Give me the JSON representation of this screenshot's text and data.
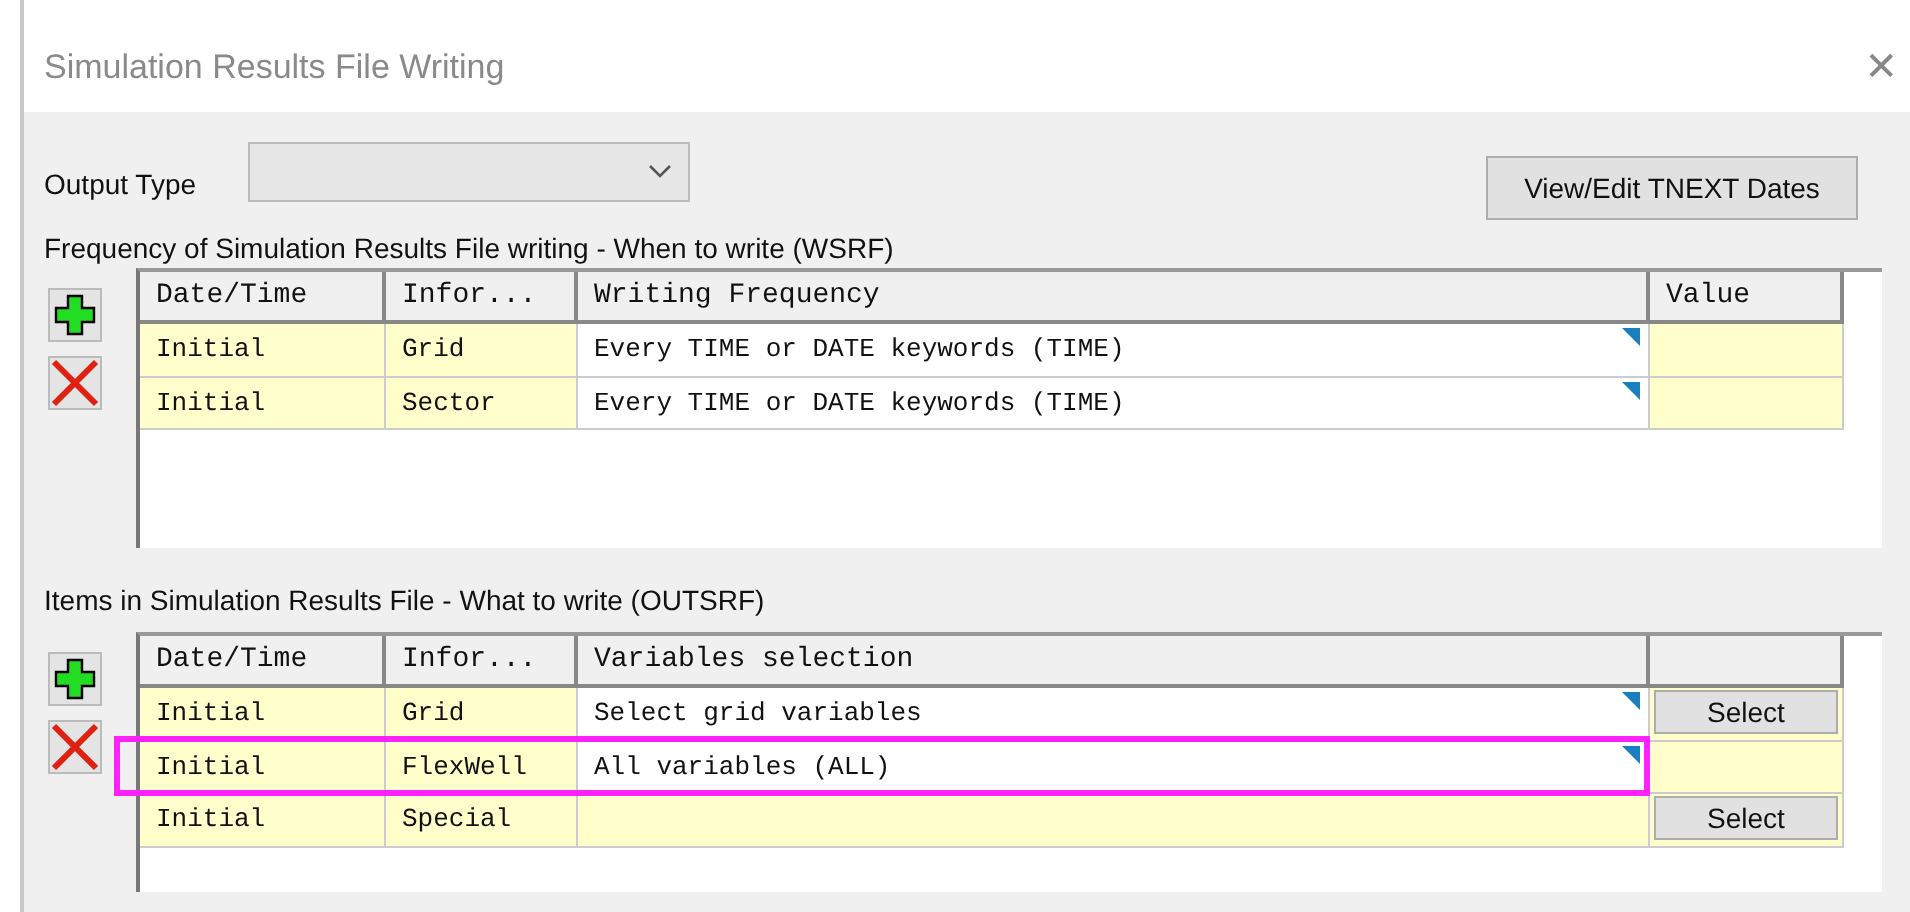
{
  "window": {
    "title": "Simulation Results File Writing",
    "close": "✕"
  },
  "output_type": {
    "label": "Output Type"
  },
  "tnext_button": "View/Edit TNEXT Dates",
  "frequency": {
    "label": "Frequency of Simulation Results File writing -  When to write (WSRF)",
    "columns": [
      "Date/Time",
      "Infor...",
      "Writing Frequency",
      "Value"
    ],
    "rows": [
      {
        "date": "Initial",
        "info": "Grid",
        "frequency": "Every TIME or DATE keywords (TIME)"
      },
      {
        "date": "Initial",
        "info": "Sector",
        "frequency": "Every TIME or DATE keywords (TIME)"
      }
    ]
  },
  "items": {
    "label": "Items in Simulation Results File - What to write (OUTSRF)",
    "columns": [
      "Date/Time",
      "Infor...",
      "Variables selection"
    ],
    "rows": [
      {
        "date": "Initial",
        "info": "Grid",
        "selection": "Select grid variables",
        "button": "Select",
        "highlighted": false
      },
      {
        "date": "Initial",
        "info": "FlexWell",
        "selection": "All variables (ALL)",
        "highlighted": true
      },
      {
        "date": "Initial",
        "info": "Special",
        "button": "Select",
        "highlighted": false
      }
    ]
  }
}
